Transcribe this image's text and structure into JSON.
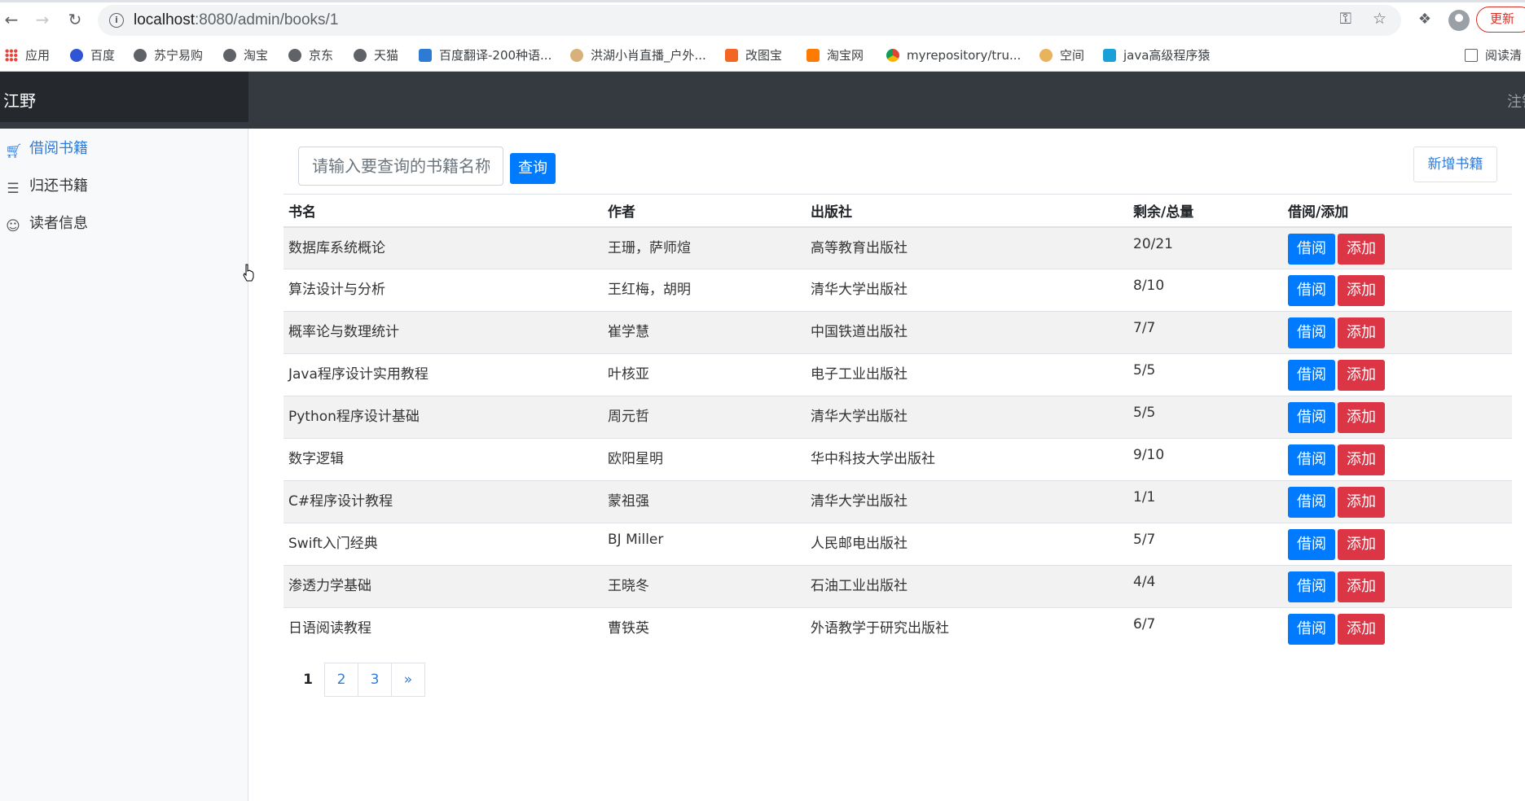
{
  "browser": {
    "url_host": "localhost",
    "url_rest": ":8080/admin/books/1",
    "update_label": "更新",
    "bookmarks": [
      {
        "label": "应用",
        "icon": "apps-grid-icon"
      },
      {
        "label": "百度",
        "icon": "baidu-paw-icon"
      },
      {
        "label": "苏宁易购",
        "icon": "globe-icon"
      },
      {
        "label": "淘宝",
        "icon": "globe-icon"
      },
      {
        "label": "京东",
        "icon": "globe-icon"
      },
      {
        "label": "天猫",
        "icon": "globe-icon"
      },
      {
        "label": "百度翻译-200种语...",
        "icon": "translate-icon"
      },
      {
        "label": "洪湖小肖直播_户外...",
        "icon": "bird-icon"
      },
      {
        "label": "改图宝",
        "icon": "image-box-icon"
      },
      {
        "label": "淘宝网",
        "icon": "taobao-icon"
      },
      {
        "label": "myrepository/tru...",
        "icon": "chrome-icon"
      },
      {
        "label": "空间",
        "icon": "qzone-icon"
      },
      {
        "label": "java高级程序猿",
        "icon": "bilibili-tv-icon"
      }
    ],
    "reading_list": "阅读清"
  },
  "app": {
    "brand": "江野",
    "logout": "注销"
  },
  "sidebar": {
    "items": [
      {
        "label": "借阅书籍",
        "icon": "cart-icon",
        "active": true
      },
      {
        "label": "归还书籍",
        "icon": "layers-icon",
        "active": false
      },
      {
        "label": "读者信息",
        "icon": "users-icon",
        "active": false
      }
    ]
  },
  "search": {
    "placeholder": "请输入要查询的书籍名称",
    "button": "查询"
  },
  "add_book_button": "新增书籍",
  "table": {
    "headers": [
      "书名",
      "作者",
      "出版社",
      "剩余/总量",
      "借阅/添加"
    ],
    "borrow_label": "借阅",
    "add_label": "添加",
    "rows": [
      [
        "数据库系统概论",
        "王珊，萨师煊",
        "高等教育出版社",
        "20/21"
      ],
      [
        "算法设计与分析",
        "王红梅，胡明",
        "清华大学出版社",
        "8/10"
      ],
      [
        "概率论与数理统计",
        "崔学慧",
        "中国铁道出版社",
        "7/7"
      ],
      [
        "Java程序设计实用教程",
        "叶核亚",
        "电子工业出版社",
        "5/5"
      ],
      [
        "Python程序设计基础",
        "周元哲",
        "清华大学出版社",
        "5/5"
      ],
      [
        "数字逻辑",
        "欧阳星明",
        "华中科技大学出版社",
        "9/10"
      ],
      [
        "C#程序设计教程",
        "蒙祖强",
        "清华大学出版社",
        "1/1"
      ],
      [
        "Swift入门经典",
        "BJ Miller",
        "人民邮电出版社",
        "5/7"
      ],
      [
        "渗透力学基础",
        "王晓冬",
        "石油工业出版社",
        "4/4"
      ],
      [
        "日语阅读教程",
        "曹铁英",
        "外语教学于研究出版社",
        "6/7"
      ]
    ]
  },
  "pagination": {
    "current": "1",
    "pages": [
      "2",
      "3"
    ],
    "next": "»"
  }
}
